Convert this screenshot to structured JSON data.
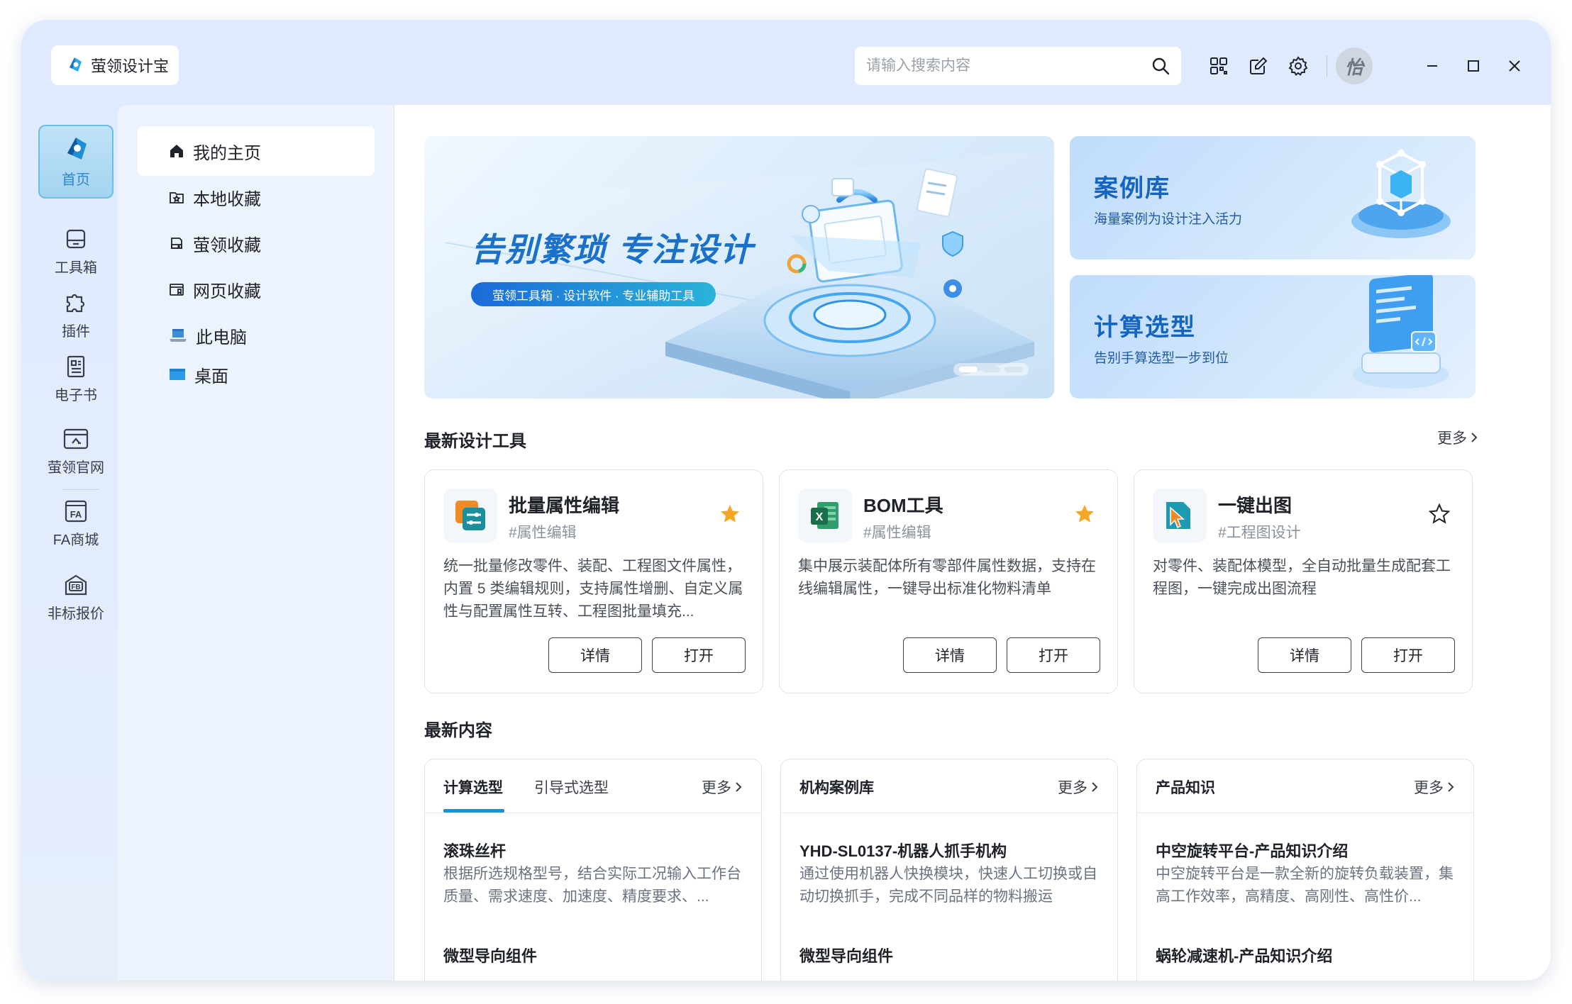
{
  "app": {
    "title": "萤领设计宝",
    "icon": "app-logo-icon"
  },
  "search": {
    "placeholder": "请输入搜索内容",
    "value": ""
  },
  "titlebar": {
    "icons": [
      "qr-code-icon",
      "edit-icon",
      "gear-icon"
    ],
    "avatar_text": "怡",
    "window_controls": [
      "minimize-icon",
      "maximize-icon",
      "close-icon"
    ]
  },
  "rail": {
    "items": [
      {
        "label": "首页",
        "icon": "home-app-icon",
        "active": true
      },
      {
        "label": "工具箱",
        "icon": "toolbox-icon"
      },
      {
        "label": "插件",
        "icon": "puzzle-icon"
      },
      {
        "label": "电子书",
        "icon": "book-icon"
      },
      {
        "label": "萤领官网",
        "icon": "website-icon"
      },
      {
        "label": "FA商城",
        "icon": "fa-mall-icon"
      },
      {
        "label": "非标报价",
        "icon": "fb-quote-icon"
      }
    ]
  },
  "sidebar": {
    "items": [
      {
        "label": "我的主页",
        "icon": "home-icon",
        "active": true
      },
      {
        "label": "本地收藏",
        "icon": "folder-star-icon"
      },
      {
        "label": "萤领收藏",
        "icon": "cloud-drive-icon"
      },
      {
        "label": "网页收藏",
        "icon": "web-bookmark-icon"
      },
      {
        "label": "此电脑",
        "icon": "computer-icon"
      },
      {
        "label": "桌面",
        "icon": "desktop-icon"
      }
    ]
  },
  "hero": {
    "title": "告别繁琐 专注设计",
    "subtitle": "萤领工具箱 · 设计软件 · 专业辅助工具",
    "slides": 3,
    "active_slide": 1
  },
  "promos": [
    {
      "title": "案例库",
      "subtitle": "海量案例为设计注入活力"
    },
    {
      "title": "计算选型",
      "subtitle": "告别手算选型一步到位"
    }
  ],
  "tools_section": {
    "title": "最新设计工具",
    "more": "更多"
  },
  "tools": [
    {
      "name": "批量属性编辑",
      "tag": "#属性编辑",
      "desc": "统一批量修改零件、装配、工程图文件属性，内置 5 类编辑规则，支持属性增删、自定义属性与配置属性互转、工程图批量填充...",
      "starred": true,
      "icon": "batch-edit-icon",
      "details_label": "详情",
      "open_label": "打开"
    },
    {
      "name": "BOM工具",
      "tag": "#属性编辑",
      "desc": "集中展示装配体所有零部件属性数据，支持在线编辑属性，一键导出标准化物料清单",
      "starred": true,
      "icon": "excel-icon",
      "details_label": "详情",
      "open_label": "打开"
    },
    {
      "name": "一键出图",
      "tag": "#工程图设计",
      "desc": "对零件、装配体模型，全自动批量生成配套工程图，一键完成出图流程",
      "starred": false,
      "icon": "drawing-icon",
      "details_label": "详情",
      "open_label": "打开"
    }
  ],
  "content_section": {
    "title": "最新内容"
  },
  "content_cards": [
    {
      "tabs": [
        "计算选型",
        "引导式选型"
      ],
      "active_tab": 0,
      "more": "更多",
      "items": [
        {
          "title": "滚珠丝杆",
          "desc": "根据所选规格型号，结合实际工况输入工作台质量、需求速度、加速度、精度要求、..."
        },
        {
          "title": "微型导向组件",
          "desc": ""
        }
      ]
    },
    {
      "tabs": [
        "机构案例库"
      ],
      "active_tab": 0,
      "more": "更多",
      "items": [
        {
          "title": "YHD-SL0137-机器人抓手机构",
          "desc": "通过使用机器人快换模块，快速人工切换或自动切换抓手，完成不同品样的物料搬运"
        },
        {
          "title": "微型导向组件",
          "desc": ""
        }
      ]
    },
    {
      "tabs": [
        "产品知识"
      ],
      "active_tab": 0,
      "more": "更多",
      "items": [
        {
          "title": "中空旋转平台-产品知识介绍",
          "desc": "中空旋转平台是一款全新的旋转负载装置，集高工作效率，高精度、高刚性、高性价..."
        },
        {
          "title": "蜗轮减速机-产品知识介绍",
          "desc": ""
        }
      ]
    }
  ],
  "colors": {
    "accent": "#1c8fd6",
    "brand_blue": "#1b70c9",
    "star": "#f5a623"
  }
}
